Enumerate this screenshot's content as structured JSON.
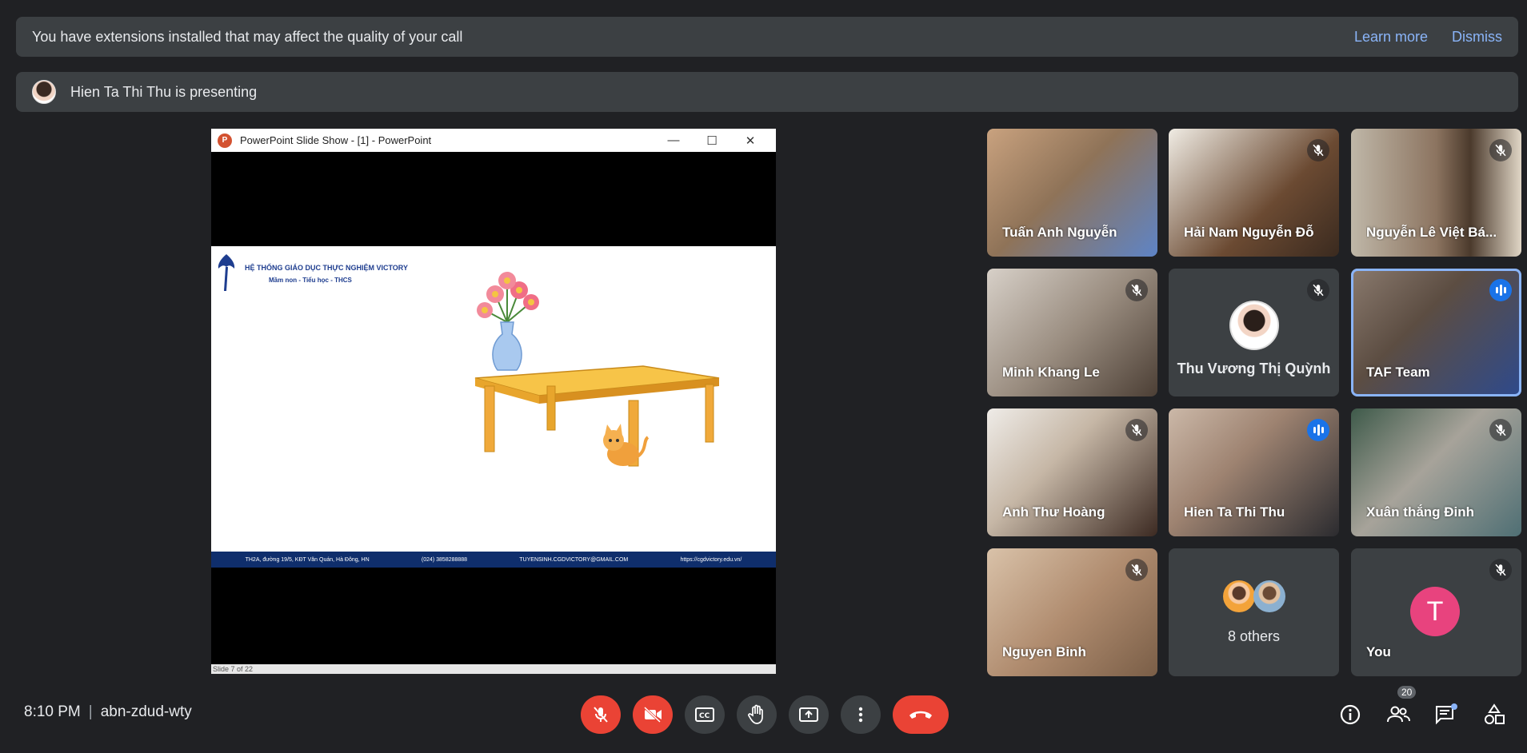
{
  "extensions_banner": {
    "message": "You have extensions installed that may affect the quality of your call",
    "learn_more": "Learn more",
    "dismiss": "Dismiss"
  },
  "presenting_banner": {
    "message": "Hien Ta Thi Thu is presenting"
  },
  "slideshow": {
    "window_title": "PowerPoint Slide Show - [1] - PowerPoint",
    "school_name": "HỆ THỐNG GIÁO DỤC THỰC NGHIỆM VICTORY",
    "school_levels": "Mầm non - Tiểu học - THCS",
    "footer_address": "TH2A, đường 19/5, KĐT Văn Quán, Hà Đông, HN",
    "footer_phone": "(024) 3858288888",
    "footer_email": "TUYENSINH.CGDVICTORY@GMAIL.COM",
    "footer_web": "https://cgdvictory.edu.vn/",
    "status": "Slide 7 of 22"
  },
  "participants": [
    {
      "name": "Tuấn Anh Nguyễn",
      "muted": false
    },
    {
      "name": "Hải Nam Nguyễn Đỗ",
      "muted": true
    },
    {
      "name": "Nguyễn Lê Việt Bá...",
      "muted": true
    },
    {
      "name": "Minh Khang Le",
      "muted": true
    },
    {
      "name": "Thu Vương Thị Quỳnh",
      "muted": true
    },
    {
      "name": "TAF Team",
      "muted": false,
      "speaking": true
    },
    {
      "name": "Anh Thư Hoàng",
      "muted": true
    },
    {
      "name": "Hien Ta Thi Thu",
      "muted": false,
      "speaking": true
    },
    {
      "name": "Xuân thắng Đinh",
      "muted": true
    },
    {
      "name": "Nguyen Binh",
      "muted": true
    },
    {
      "name": "8 others"
    },
    {
      "name": "You",
      "avatar_letter": "T",
      "muted": true
    }
  ],
  "bottom_bar": {
    "time": "8:10 PM",
    "meeting_code": "abn-zdud-wty",
    "people_count": "20"
  },
  "colors": {
    "background": "#202124",
    "surface": "#3c4043",
    "link": "#8ab4f8",
    "danger": "#ea4335",
    "active_speaker": "#1a73e8",
    "you_avatar": "#e8437e"
  }
}
